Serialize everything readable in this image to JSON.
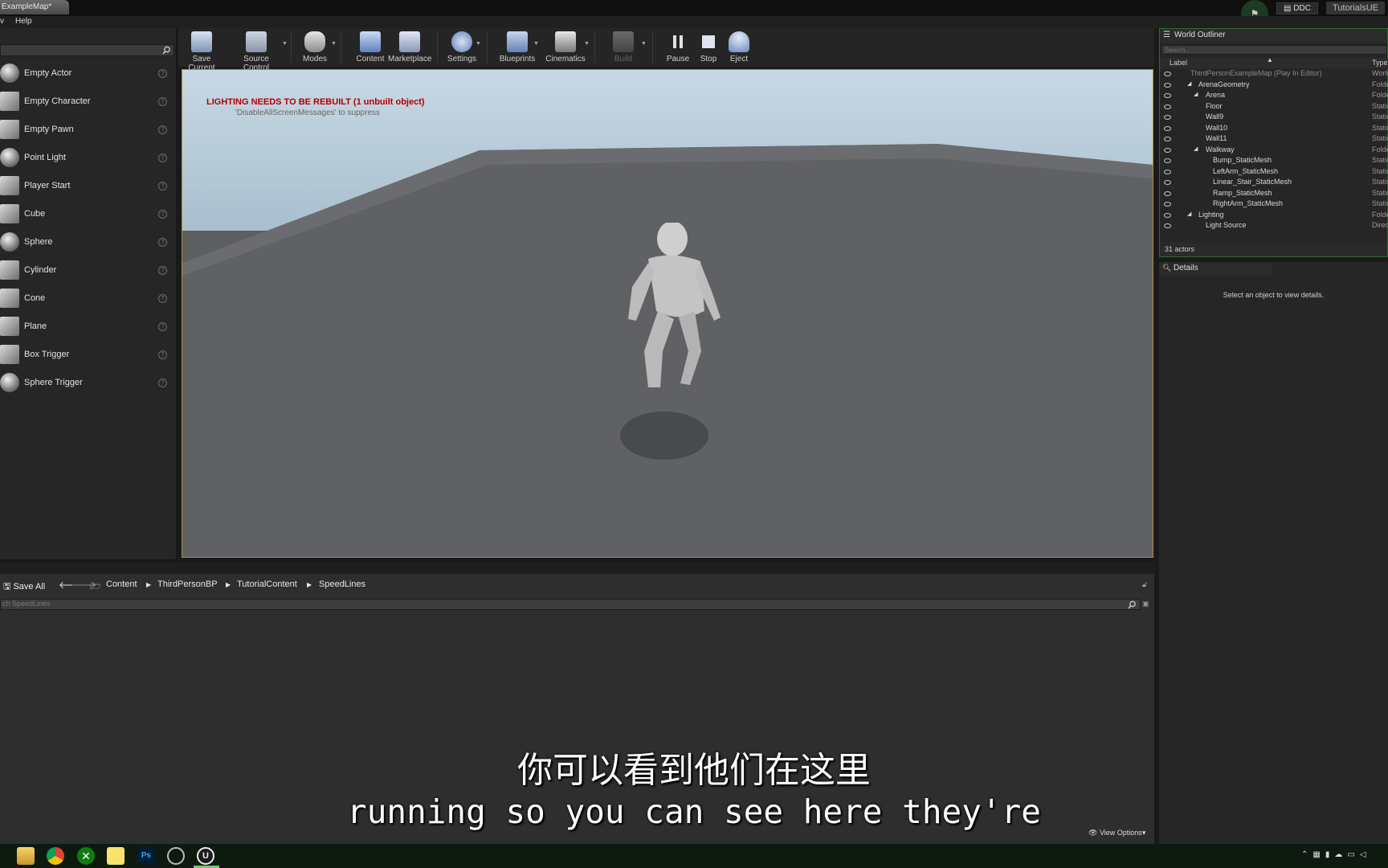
{
  "title_bar": {
    "doc_tab": "ExampleMap*",
    "ddc_label": "DDC",
    "project_label": "TutorialsUE"
  },
  "menu": {
    "item_partial": "v",
    "help": "Help"
  },
  "place_panel": {
    "items": [
      {
        "label": "Empty Actor",
        "icon": "sphere-icon"
      },
      {
        "label": "Empty Character",
        "icon": "character-icon"
      },
      {
        "label": "Empty Pawn",
        "icon": "pawn-icon"
      },
      {
        "label": "Point Light",
        "icon": "bulb-icon"
      },
      {
        "label": "Player Start",
        "icon": "player-start-icon"
      },
      {
        "label": "Cube",
        "icon": "cube-icon"
      },
      {
        "label": "Sphere",
        "icon": "sphere-icon"
      },
      {
        "label": "Cylinder",
        "icon": "cylinder-icon"
      },
      {
        "label": "Cone",
        "icon": "cone-icon"
      },
      {
        "label": "Plane",
        "icon": "plane-icon"
      },
      {
        "label": "Box Trigger",
        "icon": "box-trigger-icon"
      },
      {
        "label": "Sphere Trigger",
        "icon": "sphere-trigger-icon"
      }
    ]
  },
  "toolbar": {
    "save_current": "Save Current",
    "source_control": "Source Control",
    "modes": "Modes",
    "content": "Content",
    "marketplace": "Marketplace",
    "settings": "Settings",
    "blueprints": "Blueprints",
    "cinematics": "Cinematics",
    "build": "Build",
    "pause": "Pause",
    "stop": "Stop",
    "eject": "Eject"
  },
  "viewport": {
    "lighting_warning": "LIGHTING NEEDS TO BE REBUILT (1 unbuilt object)",
    "lighting_hint": "'DisableAllScreenMessages' to suppress"
  },
  "world_outliner": {
    "tab": "World Outliner",
    "search_placeholder": "Search...",
    "col_label": "Label",
    "col_type": "Type",
    "rows": [
      {
        "label": "ThirdPersonExampleMap (Play In Editor)",
        "type": "World"
      },
      {
        "label": "ArenaGeometry",
        "type": "Folder"
      },
      {
        "label": "Arena",
        "type": "Folder"
      },
      {
        "label": "Floor",
        "type": "Static"
      },
      {
        "label": "Wall9",
        "type": "Static"
      },
      {
        "label": "Wall10",
        "type": "Static"
      },
      {
        "label": "Wall11",
        "type": "Static"
      },
      {
        "label": "Walkway",
        "type": "Folder"
      },
      {
        "label": "Bump_StaticMesh",
        "type": "Static"
      },
      {
        "label": "LeftArm_StaticMesh",
        "type": "Static"
      },
      {
        "label": "Linear_Stair_StaticMesh",
        "type": "Static"
      },
      {
        "label": "Ramp_StaticMesh",
        "type": "Static"
      },
      {
        "label": "RightArm_StaticMesh",
        "type": "Static"
      },
      {
        "label": "Lighting",
        "type": "Folder"
      },
      {
        "label": "Light Source",
        "type": "Direc"
      }
    ],
    "actor_count": "31 actors"
  },
  "details": {
    "tab": "Details",
    "empty_message": "Select an object to view details."
  },
  "content_browser": {
    "save_all": "Save All",
    "breadcrumbs": [
      "Content",
      "ThirdPersonBP",
      "TutorialContent",
      "SpeedLines"
    ],
    "search_placeholder": "ch SpeedLines",
    "view_options": "View Options"
  },
  "subtitles": {
    "chinese": "你可以看到他们在这里",
    "english": "running so you can see here they're"
  },
  "taskbar": {
    "apps": [
      "file-explorer-icon",
      "chrome-icon",
      "xbox-icon",
      "sticky-notes-icon",
      "photoshop-icon",
      "clock-app-icon",
      "unreal-engine-icon"
    ],
    "photoshop_label": "Ps"
  }
}
